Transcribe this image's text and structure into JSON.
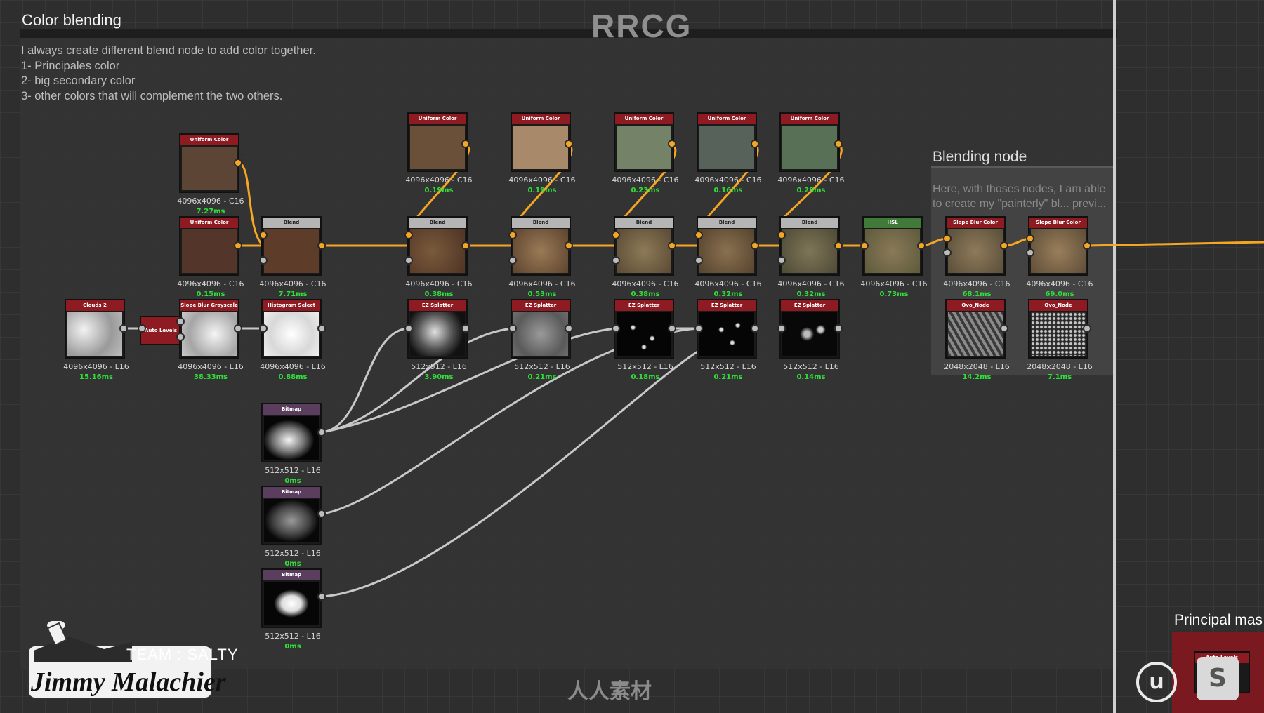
{
  "brand_watermark": "RRCG",
  "frame": {
    "title": "Color blending",
    "notes": [
      "I always create different blend node to add color together.",
      "1- Principales color",
      "2- big secondary color",
      "3- other colors that will complement the two others."
    ]
  },
  "blend_frame": {
    "title": "Blending node",
    "description": "Here, with thoses nodes, I am able to create my \"painterly\" bl... previ..."
  },
  "principal_frame": {
    "title": "Principal mas"
  },
  "colors": {
    "header_red": "#8e1b22",
    "header_gray": "#b5b5b5",
    "header_purple": "#5b3d5e",
    "header_green": "#3f7a3a",
    "wire_orange": "#f5a623",
    "wire_gray": "#c8c8c8",
    "timing_green": "#2fe03a"
  },
  "nodes": {
    "uc1": {
      "title": "Uniform Color",
      "res": "4096x4096 - C16",
      "ms": "7.27ms"
    },
    "uc2": {
      "title": "Uniform Color",
      "res": "4096x4096 - C16",
      "ms": "0.15ms"
    },
    "blend1": {
      "title": "Blend",
      "res": "4096x4096 - C16",
      "ms": "7.71ms"
    },
    "uc3": {
      "title": "Uniform Color",
      "res": "4096x4096 - C16",
      "ms": "0.19ms"
    },
    "uc4": {
      "title": "Uniform Color",
      "res": "4096x4096 - C16",
      "ms": "0.19ms"
    },
    "uc5": {
      "title": "Uniform Color",
      "res": "4096x4096 - C16",
      "ms": "0.23ms"
    },
    "uc6": {
      "title": "Uniform Color",
      "res": "4096x4096 - C16",
      "ms": "0.16ms"
    },
    "uc7": {
      "title": "Uniform Color",
      "res": "4096x4096 - C16",
      "ms": "0.28ms"
    },
    "blend2": {
      "title": "Blend",
      "res": "4096x4096 - C16",
      "ms": "0.38ms"
    },
    "blend3": {
      "title": "Blend",
      "res": "4096x4096 - C16",
      "ms": "0.53ms"
    },
    "blend4": {
      "title": "Blend",
      "res": "4096x4096 - C16",
      "ms": "0.38ms"
    },
    "blend5": {
      "title": "Blend",
      "res": "4096x4096 - C16",
      "ms": "0.32ms"
    },
    "blend6": {
      "title": "Blend",
      "res": "4096x4096 - C16",
      "ms": "0.32ms"
    },
    "hsl": {
      "title": "HSL",
      "res": "4096x4096 - C16",
      "ms": "0.73ms"
    },
    "sbc1": {
      "title": "Slope Blur Color",
      "res": "4096x4096 - C16",
      "ms": "68.1ms"
    },
    "sbc2": {
      "title": "Slope Blur Color",
      "res": "4096x4096 - C16",
      "ms": "69.0ms"
    },
    "clouds": {
      "title": "Clouds 2",
      "res": "4096x4096 - L16",
      "ms": "15.16ms"
    },
    "autolevels": {
      "title": "Auto Levels"
    },
    "sbg": {
      "title": "Slope Blur Grayscale",
      "res": "4096x4096 - L16",
      "ms": "38.33ms"
    },
    "hist": {
      "title": "Histogram Select",
      "res": "4096x4096 - L16",
      "ms": "0.88ms"
    },
    "ez1": {
      "title": "EZ Splatter",
      "res": "512x512 - L16",
      "ms": "3.90ms"
    },
    "ez2": {
      "title": "EZ Splatter",
      "res": "512x512 - L16",
      "ms": "0.21ms"
    },
    "ez3": {
      "title": "EZ Splatter",
      "res": "512x512 - L16",
      "ms": "0.18ms"
    },
    "ez4": {
      "title": "EZ Splatter",
      "res": "512x512 - L16",
      "ms": "0.21ms"
    },
    "ez5": {
      "title": "EZ Splatter",
      "res": "512x512 - L16",
      "ms": "0.14ms"
    },
    "ovo1": {
      "title": "Ovo_Node",
      "res": "2048x2048 - L16",
      "ms": "14.2ms"
    },
    "ovo2": {
      "title": "Ovo_Node",
      "res": "2048x2048 - L16",
      "ms": "7.1ms"
    },
    "bm1": {
      "title": "Bitmap",
      "res": "512x512 - L16",
      "ms": "0ms"
    },
    "bm2": {
      "title": "Bitmap",
      "res": "512x512 - L16",
      "ms": "0ms"
    },
    "bm3": {
      "title": "Bitmap",
      "res": "512x512 - L16",
      "ms": "0ms"
    },
    "pm_autolevels": {
      "title": "Auto Levels"
    }
  },
  "logo": {
    "team": "TEAM : SALTY",
    "name": "Jimmy Malachier"
  },
  "bottom_watermark": "人人素材",
  "icons": [
    "unreal-engine-icon",
    "substance-icon",
    "chef-hat-icon"
  ]
}
